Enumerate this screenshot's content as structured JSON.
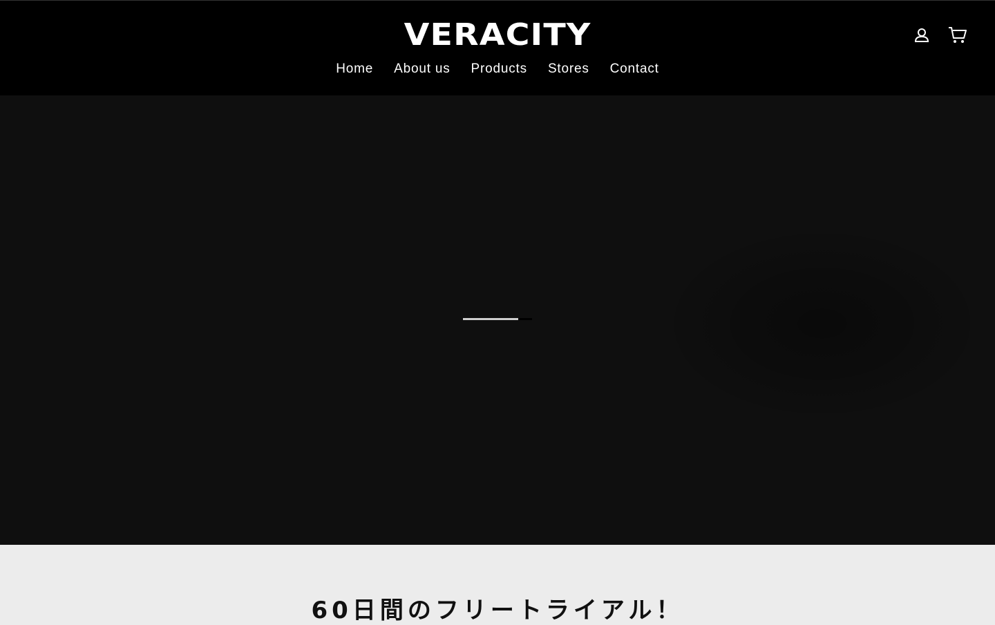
{
  "header": {
    "logo": "VERACITY",
    "nav": [
      "Home",
      "About us",
      "Products",
      "Stores",
      "Contact"
    ],
    "icons": {
      "account": "account-icon",
      "cart": "cart-icon"
    }
  },
  "hero": {
    "loading_progress": 0.8
  },
  "promo": {
    "title": "60日間のフリートライアル！"
  }
}
